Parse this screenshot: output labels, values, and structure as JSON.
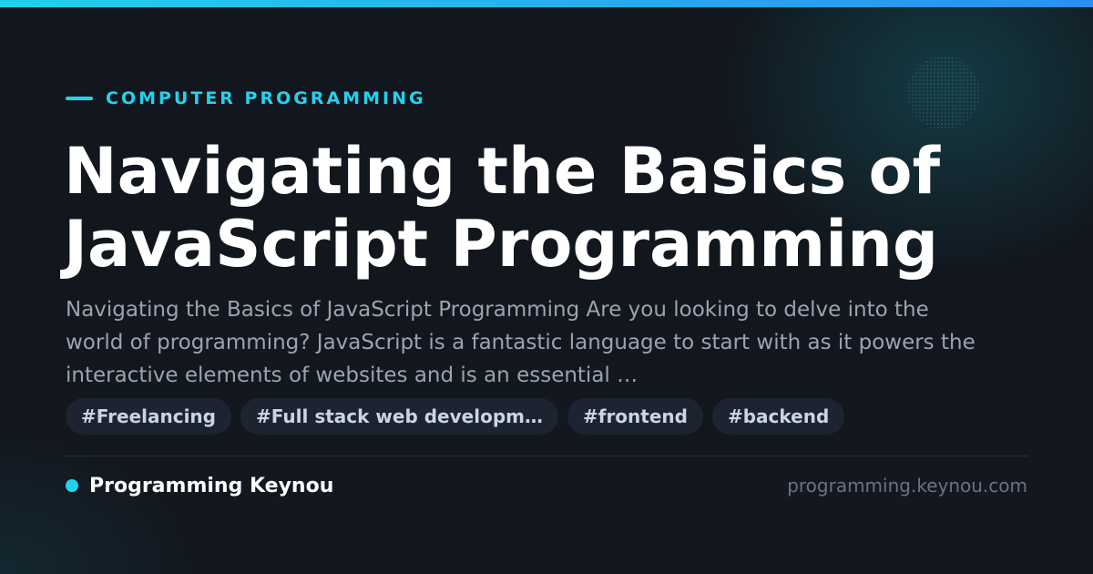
{
  "colors": {
    "accent": "#22d3ee",
    "accent_gradient_end": "#2c8ff0",
    "background": "#12161d",
    "title": "#ffffff",
    "description": "#9ca3af",
    "tag_background": "#1b2430",
    "tag_text": "#cbd5e1",
    "url": "#6b7280"
  },
  "header": {
    "category": "COMPUTER PROGRAMMING"
  },
  "article": {
    "title": "Navigating the Basics of JavaScript Programming",
    "description": "Navigating the Basics of JavaScript Programming Are you looking to delve into the world of programming? JavaScript is a fantastic language to start with as it powers the interactive elements of websites and is an essential …"
  },
  "tags": [
    {
      "label": "#Freelancing"
    },
    {
      "label": "#Full stack web developm…"
    },
    {
      "label": "#frontend"
    },
    {
      "label": "#backend"
    }
  ],
  "footer": {
    "brand": "Programming Keynou",
    "url": "programming.keynou.com"
  }
}
